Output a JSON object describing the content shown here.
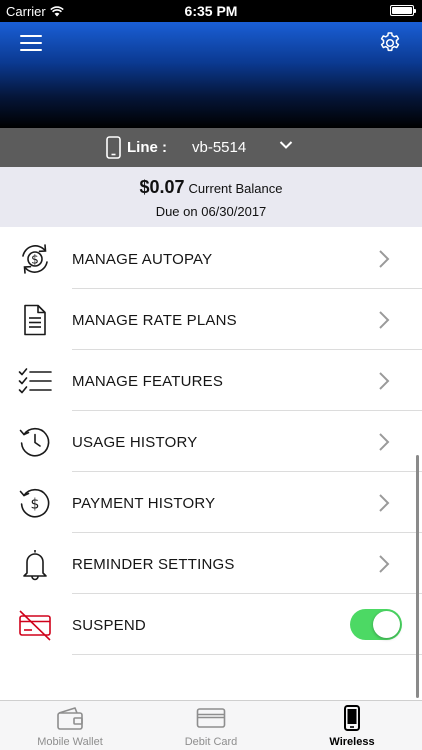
{
  "status_bar": {
    "carrier": "Carrier",
    "time": "6:35 PM"
  },
  "line": {
    "label": "Line :",
    "value": "vb-5514"
  },
  "balance": {
    "amount": "$0.07",
    "label": "Current Balance",
    "due": "Due on 06/30/2017"
  },
  "menu": {
    "items": [
      {
        "label": "MANAGE AUTOPAY",
        "icon": "autopay-icon"
      },
      {
        "label": "MANAGE RATE PLANS",
        "icon": "document-icon"
      },
      {
        "label": "MANAGE FEATURES",
        "icon": "checklist-icon"
      },
      {
        "label": "USAGE HISTORY",
        "icon": "clock-history-icon"
      },
      {
        "label": "PAYMENT HISTORY",
        "icon": "payment-history-icon"
      },
      {
        "label": "REMINDER SETTINGS",
        "icon": "bell-icon"
      },
      {
        "label": "SUSPEND",
        "icon": "card-suspend-icon",
        "toggle_on": true
      }
    ]
  },
  "tabs": [
    {
      "label": "Mobile Wallet",
      "icon": "wallet-icon",
      "active": false
    },
    {
      "label": "Debit Card",
      "icon": "card-icon",
      "active": false
    },
    {
      "label": "Wireless",
      "icon": "phone-icon",
      "active": true
    }
  ],
  "colors": {
    "accent_green": "#4cd964",
    "suspend_red": "#d0021b",
    "line_bar": "#5c5c5c"
  }
}
